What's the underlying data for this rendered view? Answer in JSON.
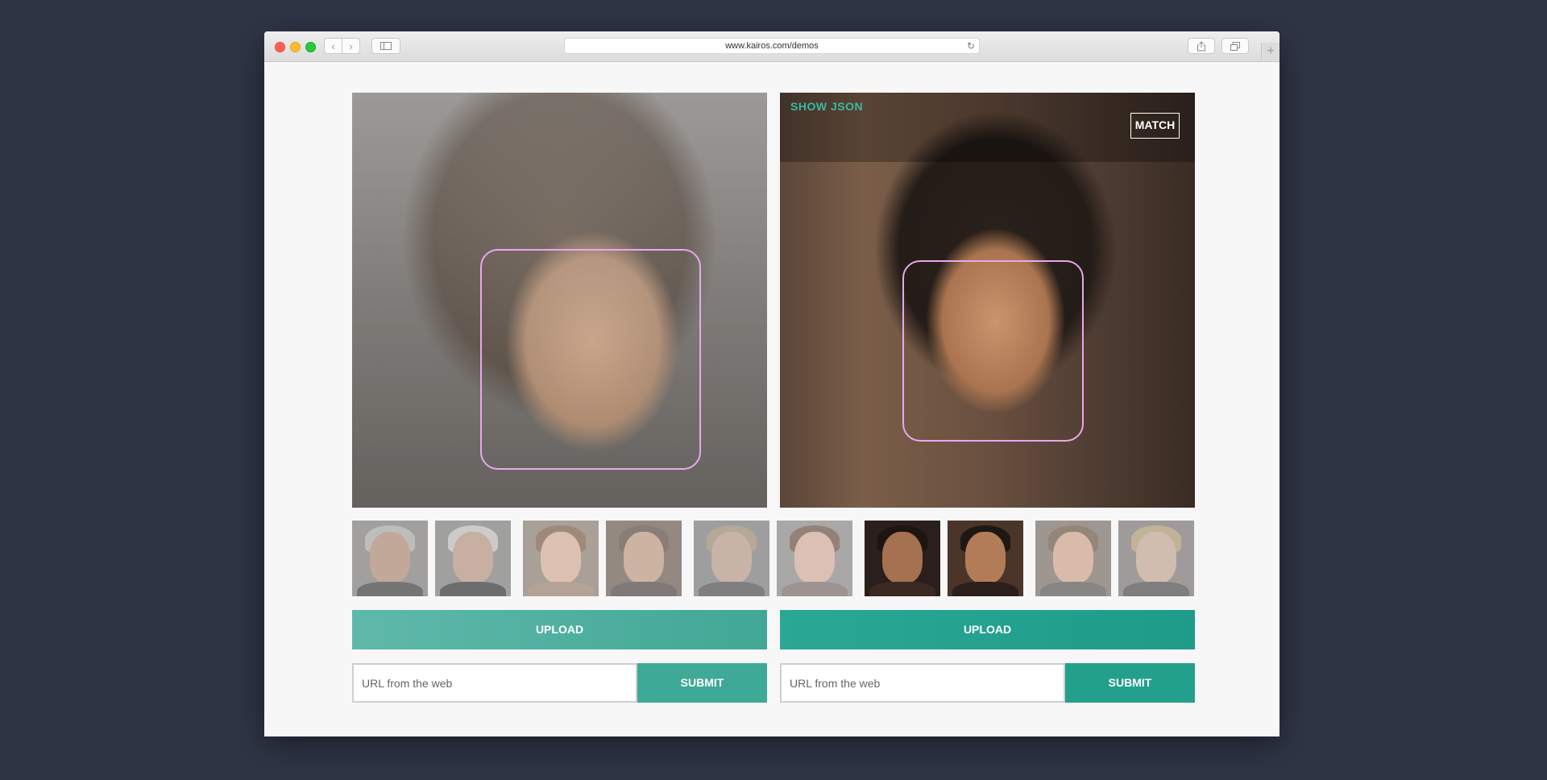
{
  "browser": {
    "url": "www.kairos.com/demos",
    "back_icon": "‹",
    "forward_icon": "›",
    "reload_icon": "↻",
    "newtab_icon": "+"
  },
  "right_panel": {
    "show_json_label": "SHOW JSON",
    "match_label": "MATCH"
  },
  "thumbnails": [
    {
      "name": "thumb-1",
      "selected": false
    },
    {
      "name": "thumb-2",
      "selected": false
    },
    {
      "name": "thumb-3",
      "selected": false
    },
    {
      "name": "thumb-4",
      "selected": false
    },
    {
      "name": "thumb-5",
      "selected": false
    },
    {
      "name": "thumb-6",
      "selected": false
    },
    {
      "name": "thumb-7",
      "selected": true
    },
    {
      "name": "thumb-8",
      "selected": true
    },
    {
      "name": "thumb-9",
      "selected": false
    },
    {
      "name": "thumb-10",
      "selected": false
    }
  ],
  "left_controls": {
    "upload_label": "UPLOAD",
    "url_placeholder": "URL from the web",
    "submit_label": "SUBMIT"
  },
  "right_controls": {
    "upload_label": "UPLOAD",
    "url_placeholder": "URL from the web",
    "submit_label": "SUBMIT"
  },
  "colors": {
    "accent": "#2aa795",
    "face_box": "#e9a7ef",
    "page_bg": "#2e3545"
  }
}
